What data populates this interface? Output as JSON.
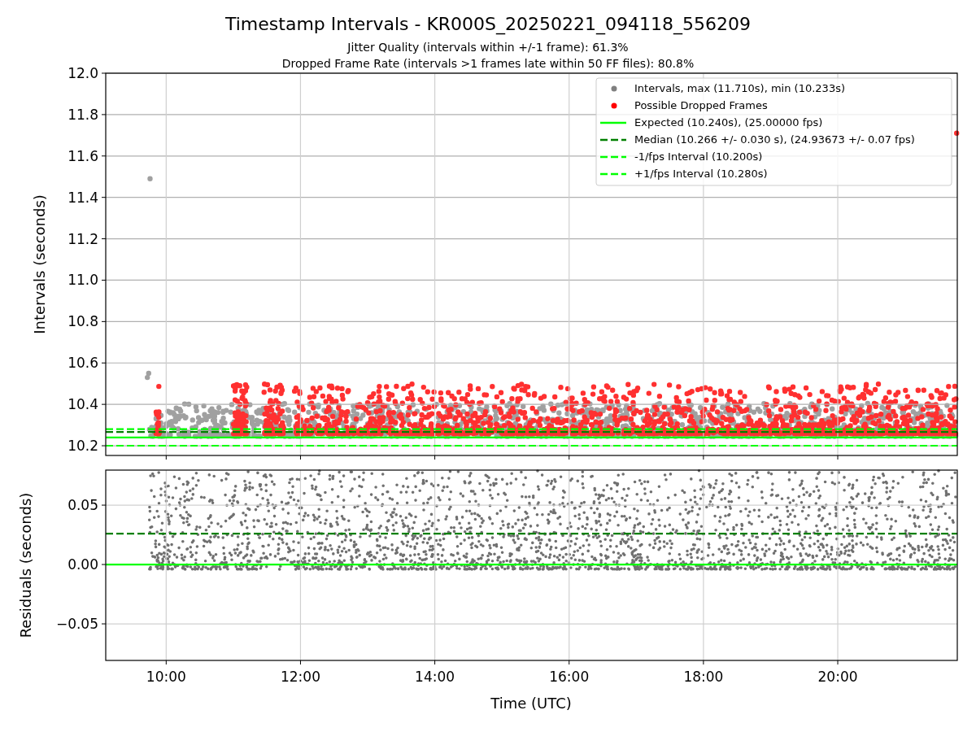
{
  "title": "Timestamp Intervals - KR000S_20250221_094118_556209",
  "subtitles": [
    "Jitter Quality (intervals within +/-1 frame): 61.3%",
    "Dropped Frame Rate (intervals >1 frames late within 50 FF files): 80.8%"
  ],
  "top_chart": {
    "scatter_legend": [
      {
        "label": "Intervals, max (11.710s), min (10.233s)",
        "color": "#808080"
      },
      {
        "label": "Possible Dropped Frames",
        "color": "#ff0000"
      }
    ],
    "chart_data": {
      "type": "line",
      "ylabel": "Intervals (seconds)",
      "x": [
        9.1,
        21.78
      ],
      "xlim": [
        9.1,
        21.78
      ],
      "ylim": [
        10.153,
        12.0
      ],
      "grid": true,
      "legend": true,
      "yticks": [
        {
          "value": 10.2,
          "label": "10.2"
        },
        {
          "value": 10.4,
          "label": "10.4"
        },
        {
          "value": 10.6,
          "label": "10.6"
        },
        {
          "value": 10.8,
          "label": "10.8"
        },
        {
          "value": 11.0,
          "label": "11.0"
        },
        {
          "value": 11.2,
          "label": "11.2"
        },
        {
          "value": 11.4,
          "label": "11.4"
        },
        {
          "value": 11.6,
          "label": "11.6"
        },
        {
          "value": 11.8,
          "label": "11.8"
        },
        {
          "value": 12.0,
          "label": "12.0"
        }
      ],
      "series": [
        {
          "name": "Expected (10.240s), (25.00000 fps)",
          "color": "#00ff00",
          "line_style": "solid",
          "values": [
            10.24,
            10.24
          ]
        },
        {
          "name": "Median (10.266 +/- 0.030 s), (24.93673 +/- 0.07 fps)",
          "color": "#008000",
          "line_style": "dashed",
          "values": [
            10.266,
            10.266
          ]
        },
        {
          "name": "-1/fps Interval (10.200s)",
          "color": "#00ff00",
          "line_style": "dashed",
          "values": [
            10.2,
            10.2
          ]
        },
        {
          "name": "+1/fps Interval (10.280s)",
          "color": "#00ff00",
          "line_style": "dashed",
          "values": [
            10.28,
            10.28
          ]
        }
      ]
    }
  },
  "bottom_chart": {
    "chart_data": {
      "type": "line",
      "xlabel": "Time (UTC)",
      "ylabel": "Residuals (seconds)",
      "x": [
        9.1,
        21.78
      ],
      "xlim": [
        9.1,
        21.78
      ],
      "ylim": [
        -0.0808,
        0.0795
      ],
      "xticks": [
        {
          "value": 10,
          "label": "10:00"
        },
        {
          "value": 12,
          "label": "12:00"
        },
        {
          "value": 14,
          "label": "14:00"
        },
        {
          "value": 16,
          "label": "16:00"
        },
        {
          "value": 18,
          "label": "18:00"
        },
        {
          "value": 20,
          "label": "20:00"
        }
      ],
      "grid": true,
      "yticks": [
        {
          "value": -0.05,
          "label": "−0.05"
        },
        {
          "value": 0,
          "label": "0.00"
        },
        {
          "value": 0.05,
          "label": "0.05"
        }
      ],
      "series": [
        {
          "color": "#00ff00",
          "line_style": "solid",
          "values": [
            0,
            0
          ]
        },
        {
          "color": "#008000",
          "line_style": "dashed",
          "values": [
            0.026,
            0.026
          ]
        }
      ]
    }
  }
}
